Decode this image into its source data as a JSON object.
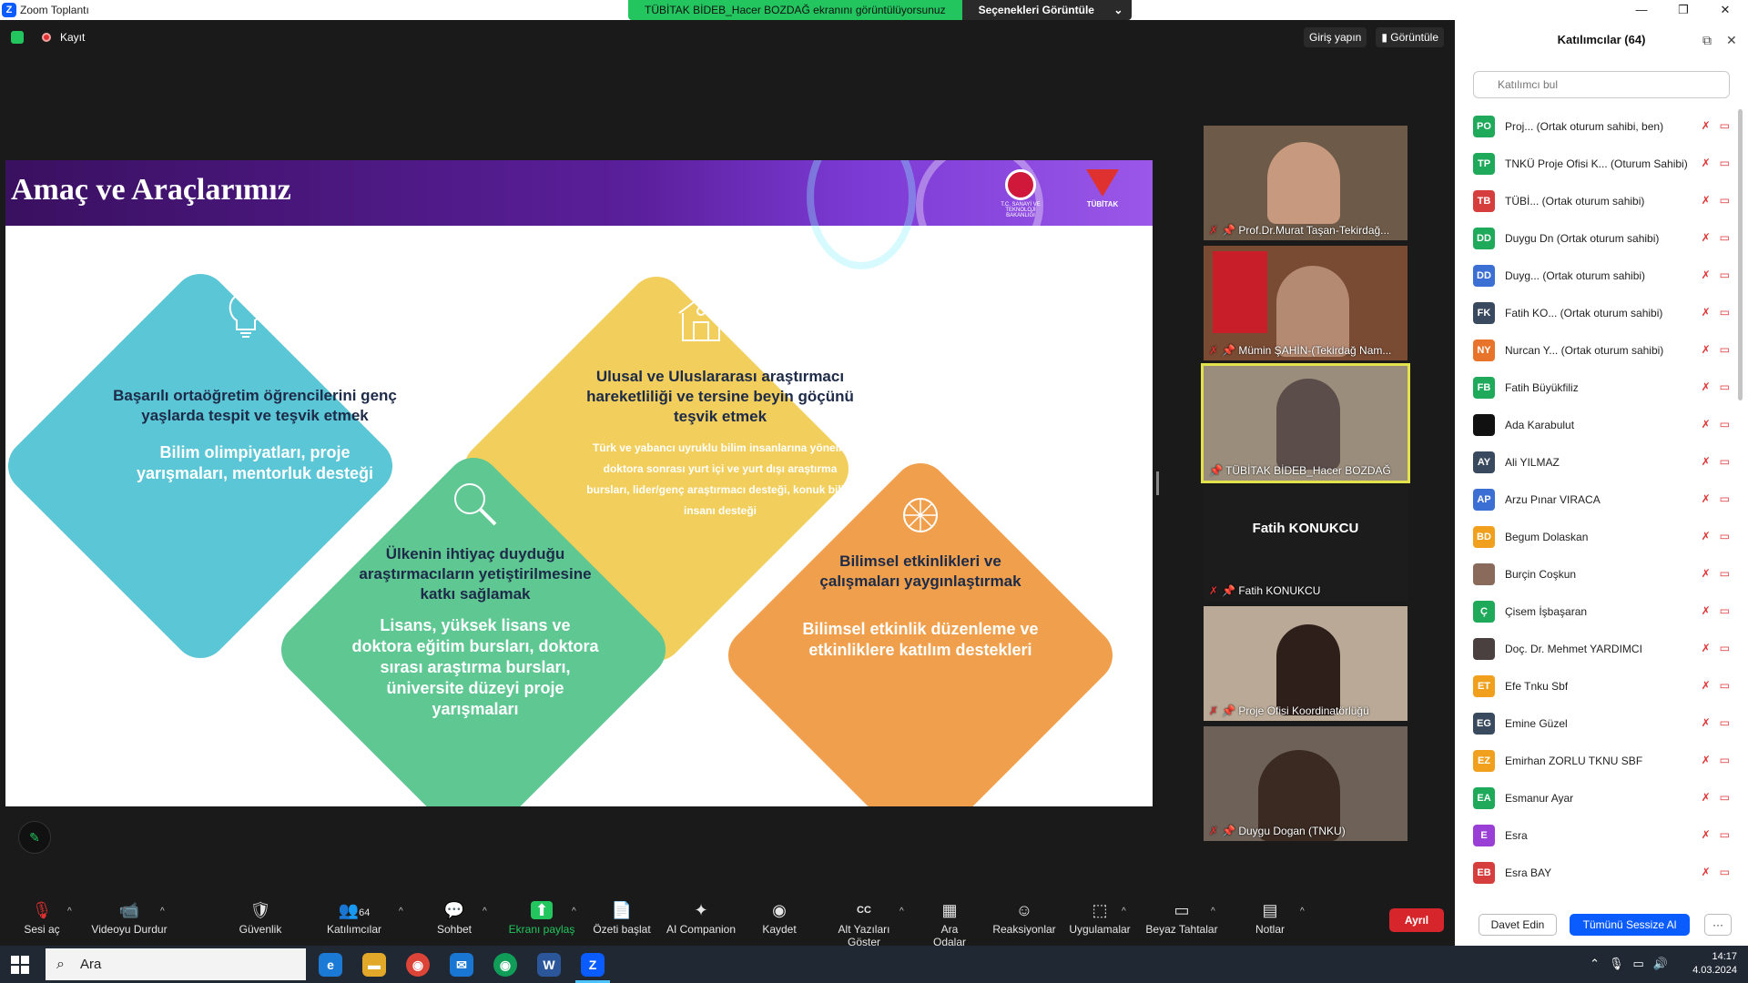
{
  "titlebar": {
    "app_title": "Zoom Toplantı",
    "minimize": "—",
    "restore": "❐",
    "close": "✕"
  },
  "share_banner": {
    "message": "TÜBİTAK BİDEB_Hacer BOZDAĞ ekranını görüntülüyorsunuz",
    "options_label": "Seçenekleri Görüntüle",
    "options_caret": "⌄"
  },
  "meeting_topbar": {
    "record_label": "Kayıt",
    "signin_label": "Giriş yapın",
    "view_label": "Görüntüle"
  },
  "slide": {
    "title": "Amaç ve Araçlarımız",
    "logo1_text": "T.C. SANAYİ VE TEKNOLOJİ BAKANLIĞI",
    "logo2_text": "TÜBİTAK",
    "diamonds": [
      {
        "heading": "Başarılı ortaöğretim öğrencilerini genç yaşlarda tespit ve teşvik etmek",
        "body": "Bilim olimpiyatları, proje yarışmaları, mentorluk desteği",
        "color": "#5bc6d6"
      },
      {
        "heading": "Ulusal ve Uluslararası araştırmacı hareketliliği ve tersine beyin göçünü teşvik etmek",
        "body": "Türk ve yabancı uyruklu bilim insanlarına yönelik doktora sonrası yurt içi ve yurt dışı araştırma bursları, lider/genç araştırmacı desteği, konuk bilim insanı desteği",
        "color": "#f2cf5c"
      },
      {
        "heading": "Ülkenin ihtiyaç duyduğu araştırmacıların yetiştirilmesine katkı sağlamak",
        "body": "Lisans, yüksek lisans ve doktora eğitim bursları, doktora sırası araştırma bursları, üniversite düzeyi proje yarışmaları",
        "color": "#5ec792"
      },
      {
        "heading": "Bilimsel etkinlikleri ve çalışmaları yaygınlaştırmak",
        "body": "Bilimsel etkinlik düzenleme ve etkinliklere katılım destekleri",
        "color": "#f0a04c"
      }
    ]
  },
  "video_tiles": [
    {
      "name": "Prof.Dr.Murat Taşan-Tekirdağ...",
      "bg": "#6e5a48"
    },
    {
      "name": "Mümin ŞAHİN-(Tekirdağ Nam...",
      "bg": "#7a4b33"
    },
    {
      "name": "TÜBİTAK BİDEB_Hacer BOZDAĞ",
      "bg": "#9a8d7c"
    },
    {
      "name": "Fatih KONUKCU",
      "bg": "#1c1c1c",
      "center_name": "Fatih KONUKCU"
    },
    {
      "name": "Proje Ofisi Koordinatörlüğü",
      "bg": "#b9a996"
    },
    {
      "name": "Duygu Dogan (TNKU)",
      "bg": "#6e6258"
    }
  ],
  "participants_panel": {
    "title": "Katılımcılar (64)",
    "search_placeholder": "Katılımcı bul",
    "invite_label": "Davet Edin",
    "mute_all_label": "Tümünü Sessize Al",
    "more_label": "···",
    "participants": [
      {
        "initials": "PO",
        "color": "#1fa95a",
        "name": "Proj...  (Ortak oturum sahibi, ben)"
      },
      {
        "initials": "TP",
        "color": "#1fa95a",
        "name": "TNKÜ Proje Ofisi K...  (Oturum Sahibi)"
      },
      {
        "initials": "TB",
        "color": "#d63d3d",
        "name": "TÜBİ...  (Ortak oturum sahibi)"
      },
      {
        "initials": "DD",
        "color": "#1fa95a",
        "name": "Duygu Dn (Ortak oturum sahibi)"
      },
      {
        "initials": "DD",
        "color": "#3b6fd4",
        "name": "Duyg...  (Ortak oturum sahibi)"
      },
      {
        "initials": "FK",
        "color": "#3a4a5e",
        "name": "Fatih KO...  (Ortak oturum sahibi)"
      },
      {
        "initials": "NY",
        "color": "#e8732a",
        "name": "Nurcan Y...  (Ortak oturum sahibi)"
      },
      {
        "initials": "FB",
        "color": "#1fa95a",
        "name": "Fatih Büyükfiliz"
      },
      {
        "initials": "",
        "color": "#111111",
        "name": "Ada Karabulut"
      },
      {
        "initials": "AY",
        "color": "#3a4a5e",
        "name": "Ali YILMAZ"
      },
      {
        "initials": "AP",
        "color": "#3b6fd4",
        "name": "Arzu Pınar VIRACA"
      },
      {
        "initials": "BD",
        "color": "#f0a01c",
        "name": "Begum Dolaskan"
      },
      {
        "initials": "",
        "color": "#8a6a5a",
        "name": "Burçin Coşkun"
      },
      {
        "initials": "Ç",
        "color": "#1fa95a",
        "name": "Çisem İşbaşaran"
      },
      {
        "initials": "",
        "color": "#4a4040",
        "name": "Doç. Dr. Mehmet YARDIMCI"
      },
      {
        "initials": "ET",
        "color": "#f0a01c",
        "name": "Efe Tnku Sbf"
      },
      {
        "initials": "EG",
        "color": "#3a4a5e",
        "name": "Emine Güzel"
      },
      {
        "initials": "EZ",
        "color": "#f0a01c",
        "name": "Emirhan ZORLU TKNU SBF"
      },
      {
        "initials": "EA",
        "color": "#1fa95a",
        "name": "Esmanur Ayar"
      },
      {
        "initials": "E",
        "color": "#9a3fd6",
        "name": "Esra"
      },
      {
        "initials": "EB",
        "color": "#d63d3d",
        "name": "Esra BAY"
      }
    ]
  },
  "toolbar": {
    "tools": [
      {
        "label": "Sesi aç",
        "icon": "🎙"
      },
      {
        "label": "Videoyu Durdur",
        "icon": "📹"
      },
      {
        "label": "Güvenlik",
        "icon": "🛡"
      },
      {
        "label": "Katılımcılar",
        "icon": "👥",
        "badge": "64"
      },
      {
        "label": "Sohbet",
        "icon": "💬"
      },
      {
        "label": "Ekranı paylaş",
        "icon": "⬆"
      },
      {
        "label": "Özeti başlat",
        "icon": "📄"
      },
      {
        "label": "AI Companion",
        "icon": "✦"
      },
      {
        "label": "Kaydet",
        "icon": "◉"
      },
      {
        "label": "Alt Yazıları Göster",
        "icon": "CC"
      },
      {
        "label": "Ara Odalar",
        "icon": "▦"
      },
      {
        "label": "Reaksiyonlar",
        "icon": "☺"
      },
      {
        "label": "Uygulamalar",
        "icon": "⬚"
      },
      {
        "label": "Beyaz Tahtalar",
        "icon": "▭"
      },
      {
        "label": "Notlar",
        "icon": "▤"
      }
    ],
    "leave_label": "Ayrıl"
  },
  "taskbar": {
    "search_placeholder": "Ara",
    "time": "14:17",
    "date": "4.03.2024"
  }
}
